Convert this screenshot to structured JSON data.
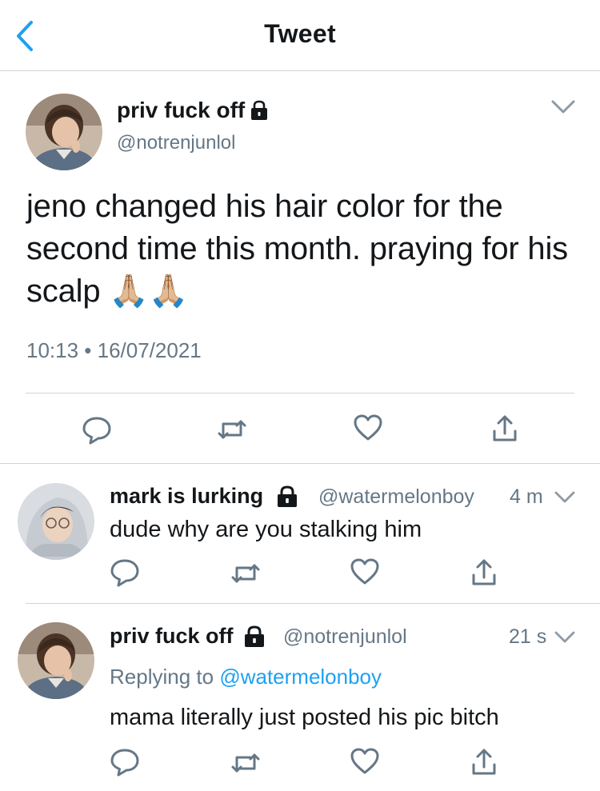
{
  "header": {
    "title": "Tweet"
  },
  "main_tweet": {
    "display_name": "priv fuck off",
    "handle": "@notrenjunlol",
    "text": "jeno changed his hair color for the second time this month. praying for his scalp 🙏🏼🙏🏼",
    "timestamp": "10:13 • 16/07/2021"
  },
  "replies": [
    {
      "display_name": "mark is lurking",
      "handle": "@watermelonboy",
      "time": "4 m",
      "text": "dude why are you stalking him"
    },
    {
      "display_name": "priv fuck off",
      "handle": "@notrenjunlol",
      "time": "21 s",
      "replying_label": "Replying to",
      "replying_handle": "@watermelonboy",
      "text": "mama literally just posted his pic bitch"
    }
  ],
  "icons": {
    "back": "chevron-left-icon",
    "menu": "chevron-down-icon",
    "reply": "speech-bubble-icon",
    "retweet": "retweet-icon",
    "like": "heart-icon",
    "share": "share-icon",
    "protected": "lock-icon"
  },
  "colors": {
    "accent": "#1da1f2",
    "secondary_text": "#657786",
    "divider": "#d4d4d8"
  }
}
